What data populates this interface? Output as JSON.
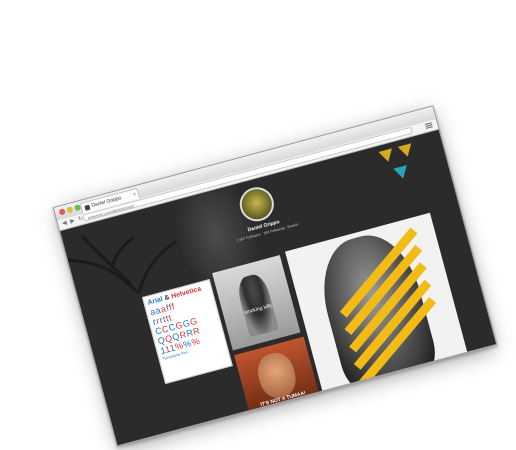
{
  "browser": {
    "tab_title": "Daniel Grippo",
    "tab_close": "×",
    "nav_buttons": "◀ ▶ ↻",
    "url": "pinterest.com/danielgrippo/",
    "icons": {
      "favicon": "favicon-icon",
      "menu": "menu-icon"
    }
  },
  "profile": {
    "name": "Daniel Grippo",
    "stats": "1,567 Followers · 256 Following · Boards"
  },
  "feed": {
    "font_card": {
      "title_a": "Arial",
      "title_amp": "&",
      "title_b": "Helvetica",
      "rows": [
        [
          {
            "t": "a",
            "c": "b"
          },
          {
            "t": "a",
            "c": "b"
          },
          {
            "t": "a",
            "c": "r"
          },
          {
            "t": "f",
            "c": "b"
          },
          {
            "t": "f",
            "c": "r"
          },
          {
            "t": "f",
            "c": "r"
          }
        ],
        [
          {
            "t": "r",
            "c": "b"
          },
          {
            "t": "r",
            "c": "r"
          },
          {
            "t": "r",
            "c": "b"
          },
          {
            "t": "t",
            "c": "r"
          },
          {
            "t": "t",
            "c": "b"
          },
          {
            "t": "t",
            "c": "r"
          }
        ],
        [
          {
            "t": "C",
            "c": "b"
          },
          {
            "t": "C",
            "c": "r"
          },
          {
            "t": "C",
            "c": "b"
          },
          {
            "t": "G",
            "c": "r"
          },
          {
            "t": "G",
            "c": "b"
          },
          {
            "t": "G",
            "c": "r"
          }
        ],
        [
          {
            "t": "Q",
            "c": "b"
          },
          {
            "t": "Q",
            "c": "r"
          },
          {
            "t": "Q",
            "c": "b"
          },
          {
            "t": "R",
            "c": "r"
          },
          {
            "t": "R",
            "c": "b"
          },
          {
            "t": "R",
            "c": "r"
          }
        ],
        [
          {
            "t": "1",
            "c": "b"
          },
          {
            "t": "1",
            "c": "r"
          },
          {
            "t": "1",
            "c": "b"
          },
          {
            "t": "%",
            "c": "r"
          },
          {
            "t": "%",
            "c": "b"
          },
          {
            "t": "%",
            "c": "r"
          }
        ]
      ],
      "caption": "Typography Pins"
    },
    "photo_card": {
      "text": "smoking kills"
    },
    "gif_card": {
      "text": "IT'S NOT A TUMAA!"
    }
  }
}
